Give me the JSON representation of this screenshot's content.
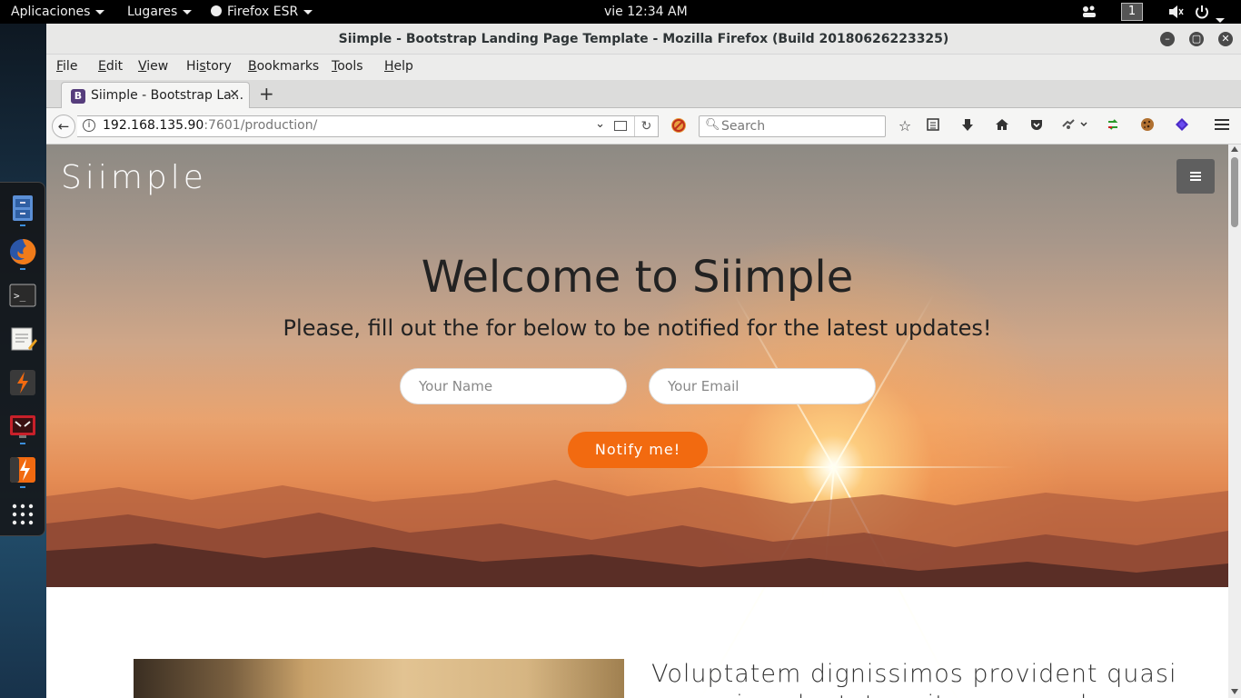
{
  "topbar": {
    "applications": "Aplicaciones",
    "places": "Lugares",
    "app_menu": "Firefox ESR",
    "clock": "vie 12:34 AM",
    "workspace": "1"
  },
  "dock": {
    "items": [
      "file-cabinet-icon",
      "firefox-icon",
      "terminal-icon",
      "text-editor-icon",
      "burp-suite-icon",
      "remote-desktop-icon",
      "burp-suite-free-icon",
      "show-apps-icon"
    ]
  },
  "window": {
    "title": "Siimple - Bootstrap Landing Page Template - Mozilla Firefox (Build 20180626223325)"
  },
  "menubar": {
    "items": [
      {
        "key": "F",
        "rest": "ile"
      },
      {
        "key": "E",
        "rest": "dit"
      },
      {
        "key": "V",
        "rest": "iew"
      },
      {
        "pre": "Hi",
        "key": "s",
        "rest": "tory"
      },
      {
        "key": "B",
        "rest": "ookmarks"
      },
      {
        "key": "T",
        "rest": "ools"
      },
      {
        "key": "H",
        "rest": "elp"
      }
    ]
  },
  "tab": {
    "favicon": "B",
    "title": "Siimple - Bootstrap La..."
  },
  "urlbar": {
    "host": "192.168.135.90",
    "path": ":7601/production/"
  },
  "searchbar": {
    "placeholder": "Search"
  },
  "page": {
    "brand": "Siimple",
    "hero_title": "Welcome to Siimple",
    "hero_subtitle": "Please, fill out the for below to be notified for the latest updates!",
    "name_placeholder": "Your Name",
    "email_placeholder": "Your Email",
    "notify_button": "Notify me!",
    "section_heading": "Voluptatem dignissimos provident quasi corporis voluptates sit assumenda."
  },
  "colors": {
    "accent": "#f26a10",
    "bootstrap_purple": "#563d7c"
  }
}
